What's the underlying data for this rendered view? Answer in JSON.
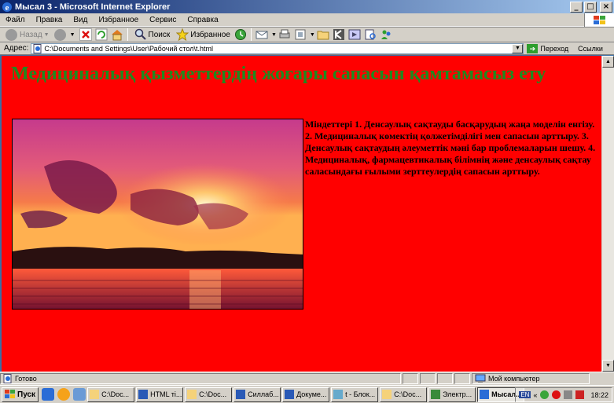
{
  "window": {
    "title": "Мысал 3 - Microsoft Internet Explorer",
    "min_label": "_",
    "max_label": "□",
    "close_label": "×"
  },
  "menu": [
    "Файл",
    "Правка",
    "Вид",
    "Избранное",
    "Сервис",
    "Справка"
  ],
  "toolbar": {
    "back": "Назад",
    "search": "Поиск",
    "favorites": "Избранное"
  },
  "address": {
    "label": "Адрес:",
    "value": "C:\\Documents and Settings\\User\\Рабочий стол\\t.html",
    "go": "Переход",
    "links": "Ссылки"
  },
  "page": {
    "heading": "Медициналық қызметтердің жоғары сапасын қамтамасыз ету",
    "tasks": "Міндеттері 1. Денсаулық сақтауды басқарудың жаңа моделін енгізу. 2. Медициналық көмектің қолжетімділігі мен сапасын арттыру. 3. Денсаулық сақтаудың әлеуметтік мәні бар проблемаларын шешу. 4. Медициналық, фармацевтикалық білімнің және денсаулық сақтау саласындағы ғылыми зерттеулердің сапасын арттыру."
  },
  "status": {
    "text": "Готово",
    "zone": "Мой компьютер"
  },
  "taskbar": {
    "start": "Пуск",
    "tasks": [
      {
        "label": "C:\\Doc...",
        "active": false
      },
      {
        "label": "HTML ті...",
        "active": false
      },
      {
        "label": "C:\\Doc...",
        "active": false
      },
      {
        "label": "Силлаб...",
        "active": false
      },
      {
        "label": "Докуме...",
        "active": false
      },
      {
        "label": "t - Блок...",
        "active": false
      },
      {
        "label": "C:\\Doc...",
        "active": false
      },
      {
        "label": "Электр...",
        "active": false
      },
      {
        "label": "Мысал...",
        "active": true
      }
    ],
    "lang": "EN",
    "clock": "18:22"
  },
  "colors": {
    "page_bg": "#ff0000",
    "heading": "#1f8a1f"
  }
}
